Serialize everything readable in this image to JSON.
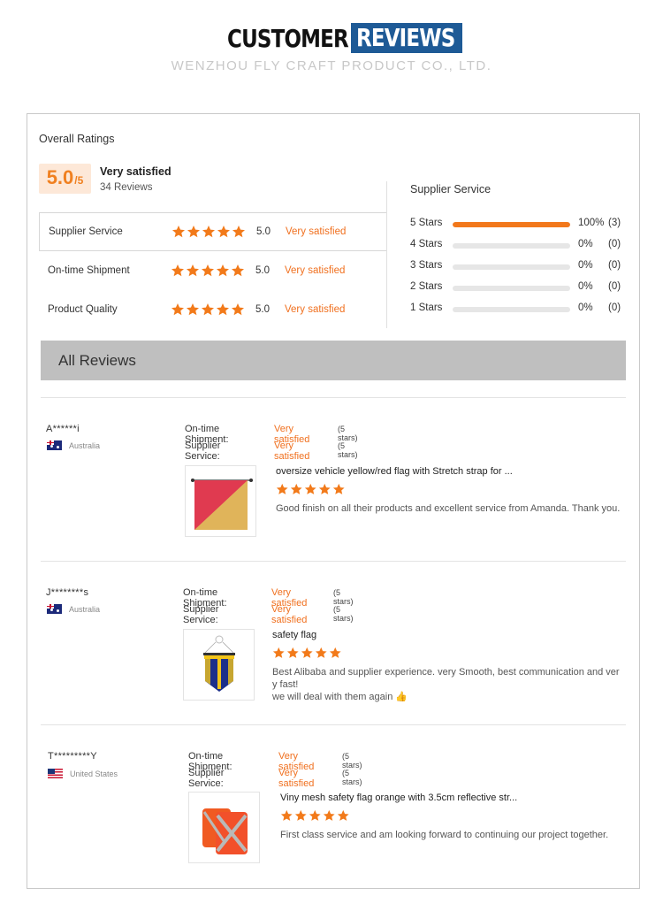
{
  "header": {
    "title_part1": "CUSTOMER",
    "title_part2": "REVIEWS",
    "subtitle": "WENZHOU FLY CRAFT PRODUCT CO., LTD."
  },
  "overall": {
    "label": "Overall Ratings",
    "score": "5.0",
    "score_max": "/5",
    "text": "Very satisfied",
    "count": "34 Reviews",
    "rows": [
      {
        "label": "Supplier Service",
        "stars": 5,
        "value": "5.0",
        "text": "Very satisfied"
      },
      {
        "label": "On-time Shipment",
        "stars": 5,
        "value": "5.0",
        "text": "Very satisfied"
      },
      {
        "label": "Product Quality",
        "stars": 5,
        "value": "5.0",
        "text": "Very satisfied"
      }
    ]
  },
  "supplier_service": {
    "title": "Supplier Service",
    "distribution": [
      {
        "label": "5  Stars",
        "fraction": 1.0,
        "pct": "100%",
        "count": "(3)"
      },
      {
        "label": "4  Stars",
        "fraction": 0,
        "pct": "0%",
        "count": "(0)"
      },
      {
        "label": "3  Stars",
        "fraction": 0,
        "pct": "0%",
        "count": "(0)"
      },
      {
        "label": "2  Stars",
        "fraction": 0,
        "pct": "0%",
        "count": "(0)"
      },
      {
        "label": "1  Stars",
        "fraction": 0,
        "pct": "0%",
        "count": "(0)"
      }
    ]
  },
  "all_reviews": {
    "title": "All Reviews",
    "items": [
      {
        "user": "A******i",
        "country": "Australia",
        "flag": "au",
        "shipment_label": "On-time Shipment:",
        "shipment_value": "Very satisfied",
        "shipment_stars": "(5 stars)",
        "service_label": "Supplier Service:",
        "service_value": "Very satisfied",
        "service_stars": "(5 stars)",
        "product": "oversize vehicle yellow/red flag with Stretch strap for ...",
        "rating": 5,
        "text": "Good finish on all their products and excellent service from Amanda. Thank you."
      },
      {
        "user": "J********s",
        "country": "Australia",
        "flag": "au",
        "shipment_label": "On-time Shipment:",
        "shipment_value": "Very satisfied",
        "shipment_stars": "(5 stars)",
        "service_label": "Supplier Service:",
        "service_value": "Very satisfied",
        "service_stars": "(5 stars)",
        "product": "safety flag",
        "rating": 5,
        "text_line1": "Best Alibaba and supplier experience.  very Smooth, best communication and ver",
        "text_line2": "y fast!",
        "text_line3": "we will deal with them again 👍"
      },
      {
        "user": "T*********Y",
        "country": "United States",
        "flag": "us",
        "shipment_label": "On-time Shipment:",
        "shipment_value": "Very satisfied",
        "shipment_stars": "(5 stars)",
        "service_label": "Supplier Service:",
        "service_value": "Very satisfied",
        "service_stars": "(5 stars)",
        "product": "Viny mesh safety flag orange with 3.5cm reflective str...",
        "rating": 5,
        "text": "First class service and am looking forward to continuing our project together."
      }
    ]
  },
  "colors": {
    "accent": "#f27a1a",
    "brand_blue": "#1e5a96",
    "header_bar": "#bfbfbf"
  }
}
